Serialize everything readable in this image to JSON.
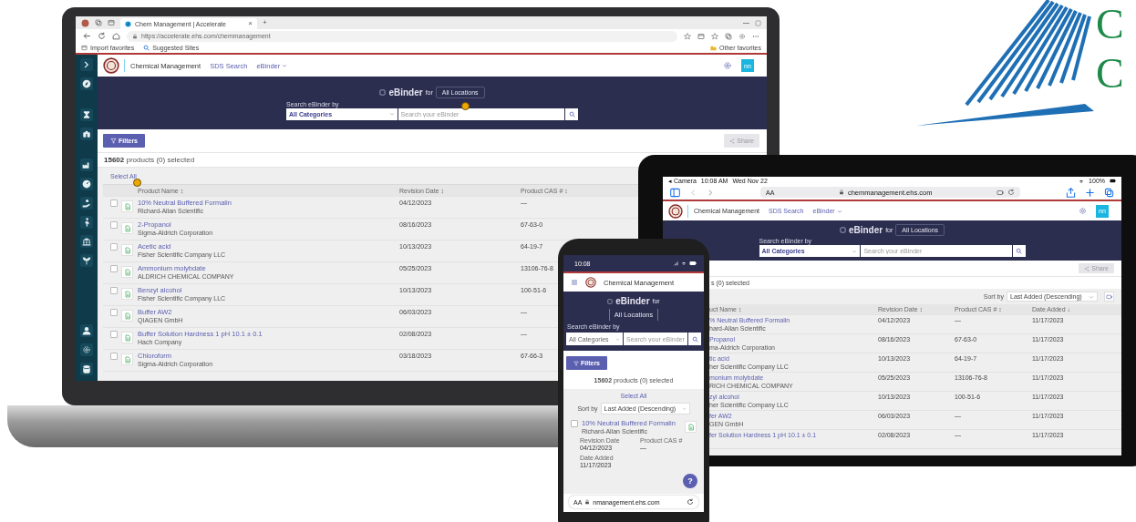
{
  "logo": {
    "letters": [
      "C",
      "C"
    ]
  },
  "laptop": {
    "browser": {
      "tab_title": "Chem Management | Accelerate",
      "tab_close": "×",
      "new_tab": "+",
      "url": "https://accelerate.ehs.com/chemmanagement",
      "favorites": [
        "Import favorites",
        "Suggested Sites"
      ],
      "other_favorites": "Other favorites"
    },
    "header": {
      "brand": "Chemical Management",
      "nav": [
        "SDS Search",
        "eBinder"
      ],
      "avatar": "nn"
    },
    "banner": {
      "title": "eBinder",
      "for": "for",
      "location": "All Locations",
      "search_label": "Search eBinder by",
      "category": "All Categories",
      "placeholder": "Search your eBinder"
    },
    "toolbar": {
      "filters": "Filters",
      "share": "Share",
      "share_disabled": true
    },
    "count": "15602",
    "count_text": "products (0) selected",
    "select_all": "Select All",
    "columns": [
      "Product Name ↕",
      "Revision Date ↕",
      "Product CAS # ↕"
    ],
    "rows": [
      {
        "name": "10% Neutral Buffered Formalin",
        "company": "Richard-Allan Scientific",
        "date": "04/12/2023",
        "cas": "—",
        "checked": false
      },
      {
        "name": "2-Propanol",
        "company": "Sigma-Aldrich Corporation",
        "date": "08/16/2023",
        "cas": "67-63-0",
        "checked": false
      },
      {
        "name": "Acetic acid",
        "company": "Fisher Scientific Company LLC",
        "date": "10/13/2023",
        "cas": "64-19-7",
        "checked": false
      },
      {
        "name": "Ammonium molybdate",
        "company": "ALDRICH CHEMICAL COMPANY",
        "date": "05/25/2023",
        "cas": "13106-76-8",
        "checked": false
      },
      {
        "name": "Benzyl alcohol",
        "company": "Fisher Scientific Company LLC",
        "date": "10/13/2023",
        "cas": "100-51-6",
        "checked": false
      },
      {
        "name": "Buffer AW2",
        "company": "QIAGEN GmbH",
        "date": "06/03/2023",
        "cas": "—",
        "checked": false
      },
      {
        "name": "Buffer Solution Hardness 1 pH 10.1 ± 0.1",
        "company": "Hach Company",
        "date": "02/08/2023",
        "cas": "—",
        "checked": false
      },
      {
        "name": "Chloroform",
        "company": "Sigma-Aldrich Corporation",
        "date": "03/18/2023",
        "cas": "67-66-3",
        "checked": false
      }
    ]
  },
  "tablet": {
    "status": {
      "back": "◂ Camera",
      "time": "10:08 AM",
      "date": "Wed Nov 22",
      "battery": "100%"
    },
    "text_size": "AA",
    "url": "chemmanagement.ehs.com",
    "header": {
      "brand": "Chemical Management",
      "nav": [
        "SDS Search",
        "eBinder"
      ],
      "avatar": "nn"
    },
    "banner": {
      "title": "eBinder",
      "for": "for",
      "location": "All Locations",
      "search_label": "Search eBinder by",
      "category": "All Categories",
      "placeholder": "Search your eBinder"
    },
    "toolbar": {
      "share": "Share",
      "share_disabled": true
    },
    "count_text": "s (0) selected",
    "sort_label": "Sort by",
    "sort": "Last Added (Descending)",
    "columns": [
      "uct Name ↕",
      "Revision Date ↕",
      "Product CAS # ↕",
      "Date Added ↓"
    ],
    "rows": [
      {
        "name": "% Neutral Buffered Formalin",
        "company": "hard-Allan Scientific",
        "date": "04/12/2023",
        "cas": "—",
        "added": "11/17/2023"
      },
      {
        "name": "Propanol",
        "company": "ma-Aldrich Corporation",
        "date": "08/16/2023",
        "cas": "67-63-0",
        "added": "11/17/2023"
      },
      {
        "name": "tic acid",
        "company": "her Scientific Company LLC",
        "date": "10/13/2023",
        "cas": "64-19-7",
        "added": "11/17/2023"
      },
      {
        "name": "monium molybdate",
        "company": "RICH CHEMICAL COMPANY",
        "date": "05/25/2023",
        "cas": "13106-76-8",
        "added": "11/17/2023"
      },
      {
        "name": "zyl alcohol",
        "company": "her Scientific Company LLC",
        "date": "10/13/2023",
        "cas": "100-51-6",
        "added": "11/17/2023"
      },
      {
        "name": "fer AW2",
        "company": "GEN GmbH",
        "date": "06/03/2023",
        "cas": "—",
        "added": "11/17/2023"
      },
      {
        "name": "fer Solution Hardness 1 pH 10.1 ± 0.1",
        "company": "",
        "date": "02/08/2023",
        "cas": "—",
        "added": "11/17/2023"
      }
    ]
  },
  "phone": {
    "time": "10:08",
    "brand": "Chemical Management",
    "banner": {
      "title": "eBinder",
      "for": "for",
      "location": "All Locations",
      "search_label": "Search eBinder by",
      "category": "All Categories",
      "placeholder": "Search your eBinder"
    },
    "filters": "Filters",
    "count": "15602",
    "count_text": "products (0) selected",
    "select_all": "Select All",
    "sort_label": "Sort by",
    "sort": "Last Added (Descending)",
    "card": {
      "name": "10% Neutral Buffered Formalin",
      "company": "Richard-Allan Scientific",
      "checked": false,
      "fields": [
        {
          "label": "Revision Date",
          "value": "04/12/2023"
        },
        {
          "label": "Product CAS #",
          "value": "—"
        },
        {
          "label": "Date Added",
          "value": "11/17/2023"
        }
      ]
    },
    "help": "?",
    "text_size": "AA",
    "url": "nmanagement.ehs.com"
  }
}
